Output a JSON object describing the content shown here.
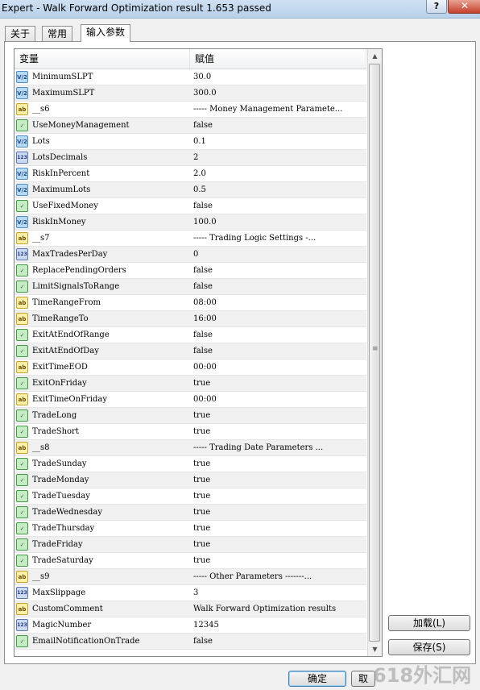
{
  "window": {
    "title": "Expert - Walk Forward Optimization result 1.653 passed",
    "help_label": "?",
    "close_label": "✕"
  },
  "tabs": [
    {
      "label": "关于",
      "active": false
    },
    {
      "label": "常用",
      "active": false
    },
    {
      "label": "输入参数",
      "active": true
    }
  ],
  "grid": {
    "headers": {
      "name": "变量",
      "value": "赋值"
    },
    "rows": [
      {
        "type": "double",
        "icon": "V/2",
        "name": "MinimumSLPT",
        "value": "30.0"
      },
      {
        "type": "double",
        "icon": "V/2",
        "name": "MaximumSLPT",
        "value": "300.0"
      },
      {
        "type": "string",
        "icon": "ab",
        "name": "__s6",
        "value": "-----  Money Management Paramete..."
      },
      {
        "type": "bool",
        "icon": "✓",
        "name": "UseMoneyManagement",
        "value": "false"
      },
      {
        "type": "double",
        "icon": "V/2",
        "name": "Lots",
        "value": "0.1"
      },
      {
        "type": "int",
        "icon": "123",
        "name": "LotsDecimals",
        "value": "2"
      },
      {
        "type": "double",
        "icon": "V/2",
        "name": "RiskInPercent",
        "value": "2.0"
      },
      {
        "type": "double",
        "icon": "V/2",
        "name": "MaximumLots",
        "value": "0.5"
      },
      {
        "type": "bool",
        "icon": "✓",
        "name": "UseFixedMoney",
        "value": "false"
      },
      {
        "type": "double",
        "icon": "V/2",
        "name": "RiskInMoney",
        "value": "100.0"
      },
      {
        "type": "string",
        "icon": "ab",
        "name": "__s7",
        "value": "-----  Trading Logic Settings  -..."
      },
      {
        "type": "int",
        "icon": "123",
        "name": "MaxTradesPerDay",
        "value": "0"
      },
      {
        "type": "bool",
        "icon": "✓",
        "name": "ReplacePendingOrders",
        "value": "false"
      },
      {
        "type": "bool",
        "icon": "✓",
        "name": "LimitSignalsToRange",
        "value": "false"
      },
      {
        "type": "string",
        "icon": "ab",
        "name": "TimeRangeFrom",
        "value": "08:00"
      },
      {
        "type": "string",
        "icon": "ab",
        "name": "TimeRangeTo",
        "value": "16:00"
      },
      {
        "type": "bool",
        "icon": "✓",
        "name": "ExitAtEndOfRange",
        "value": "false"
      },
      {
        "type": "bool",
        "icon": "✓",
        "name": "ExitAtEndOfDay",
        "value": "false"
      },
      {
        "type": "string",
        "icon": "ab",
        "name": "ExitTimeEOD",
        "value": "00:00"
      },
      {
        "type": "bool",
        "icon": "✓",
        "name": "ExitOnFriday",
        "value": "true"
      },
      {
        "type": "string",
        "icon": "ab",
        "name": "ExitTimeOnFriday",
        "value": "00:00"
      },
      {
        "type": "bool",
        "icon": "✓",
        "name": "TradeLong",
        "value": "true"
      },
      {
        "type": "bool",
        "icon": "✓",
        "name": "TradeShort",
        "value": "true"
      },
      {
        "type": "string",
        "icon": "ab",
        "name": "__s8",
        "value": "-----  Trading Date Parameters  ..."
      },
      {
        "type": "bool",
        "icon": "✓",
        "name": "TradeSunday",
        "value": "true"
      },
      {
        "type": "bool",
        "icon": "✓",
        "name": "TradeMonday",
        "value": "true"
      },
      {
        "type": "bool",
        "icon": "✓",
        "name": "TradeTuesday",
        "value": "true"
      },
      {
        "type": "bool",
        "icon": "✓",
        "name": "TradeWednesday",
        "value": "true"
      },
      {
        "type": "bool",
        "icon": "✓",
        "name": "TradeThursday",
        "value": "true"
      },
      {
        "type": "bool",
        "icon": "✓",
        "name": "TradeFriday",
        "value": "true"
      },
      {
        "type": "bool",
        "icon": "✓",
        "name": "TradeSaturday",
        "value": "true"
      },
      {
        "type": "string",
        "icon": "ab",
        "name": "__s9",
        "value": "-----  Other Parameters  -------..."
      },
      {
        "type": "int",
        "icon": "123",
        "name": "MaxSlippage",
        "value": "3"
      },
      {
        "type": "string",
        "icon": "ab",
        "name": "CustomComment",
        "value": "Walk Forward Optimization results"
      },
      {
        "type": "int",
        "icon": "123",
        "name": "MagicNumber",
        "value": "12345"
      },
      {
        "type": "bool",
        "icon": "✓",
        "name": "EmailNotificationOnTrade",
        "value": "false"
      }
    ]
  },
  "buttons": {
    "load": "加载(L)",
    "save": "保存(S)",
    "ok": "确定",
    "cancel": "取"
  },
  "watermark": "618外汇网"
}
